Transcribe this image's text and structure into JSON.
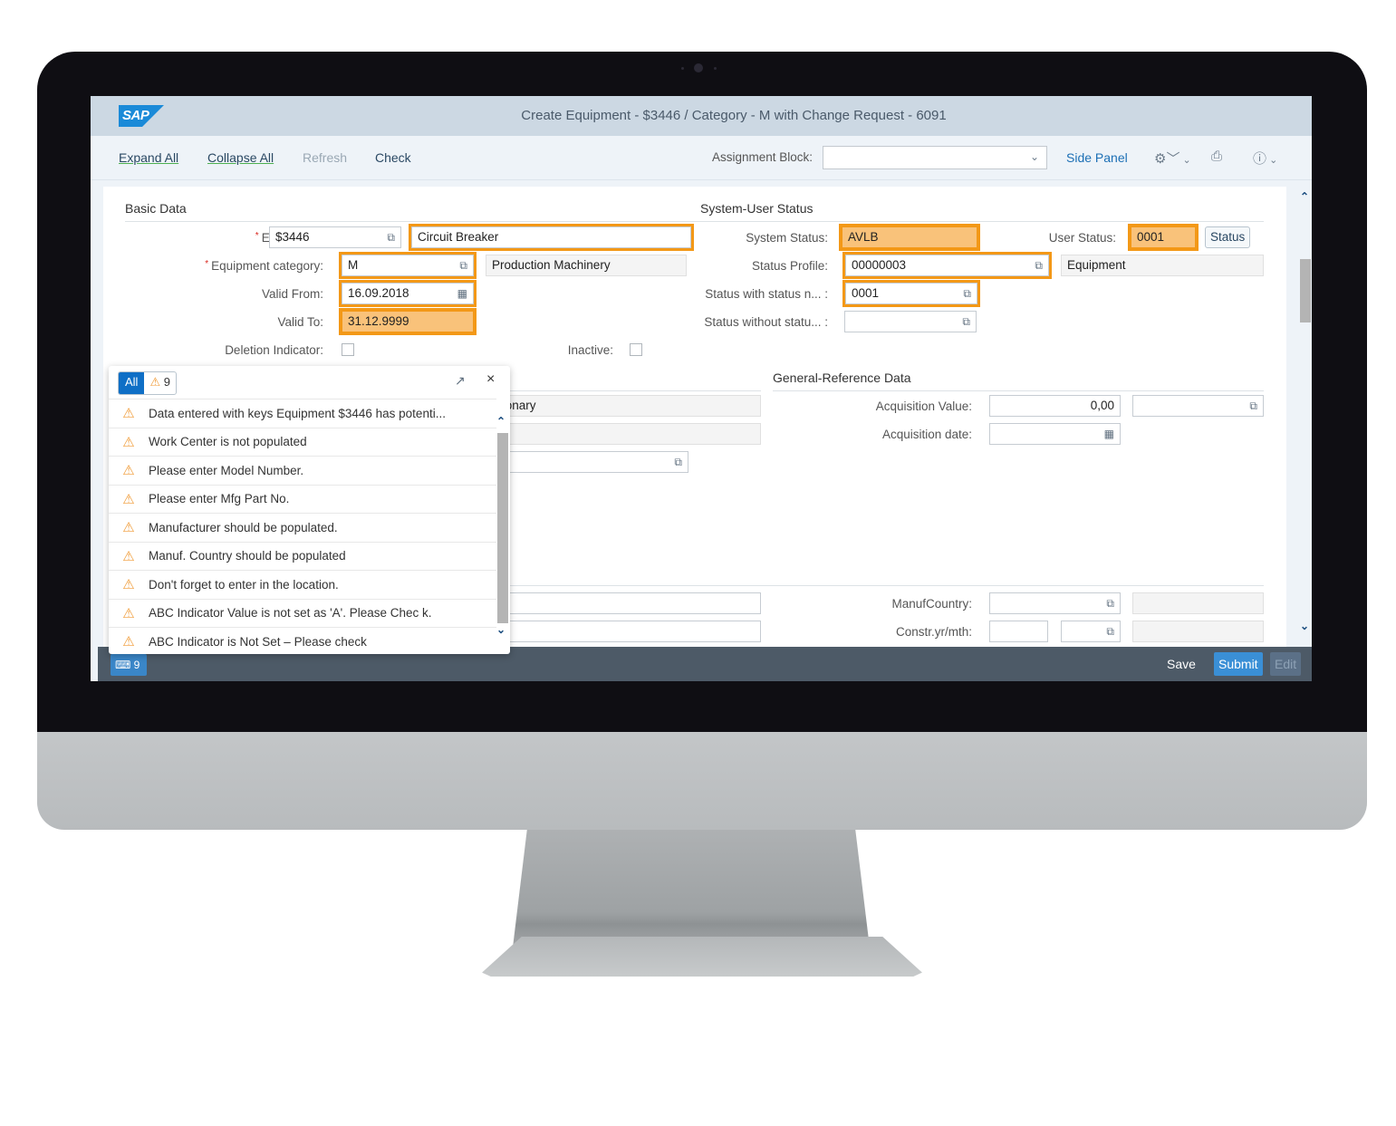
{
  "window": {
    "logo": "SAP",
    "title": "Create Equipment - $3446 / Category - M with Change Request - 6091"
  },
  "toolbar": {
    "expand_all": "Expand All",
    "collapse_all": "Collapse All",
    "refresh": "Refresh",
    "check": "Check",
    "assignment_block_label": "Assignment Block:",
    "assignment_block_value": "",
    "side_panel": "Side Panel",
    "icons": [
      "settings-icon",
      "print-icon",
      "help-icon"
    ]
  },
  "basic_data": {
    "title": "Basic Data",
    "equipment_label": "Equipment:",
    "equipment_value": "$3446",
    "equipment_description": "Circuit Breaker",
    "category_label": "Equipment category:",
    "category_value": "M",
    "category_description": "Production Machinery",
    "valid_from_label": "Valid From:",
    "valid_from_value": "16.09.2018",
    "valid_to_label": "Valid To:",
    "valid_to_value": "31.12.9999",
    "deletion_indicator_label": "Deletion Indicator:",
    "deletion_indicator_checked": false,
    "inactive_label": "Inactive:",
    "inactive_checked": false
  },
  "system_user_status": {
    "title": "System-User Status",
    "system_status_label": "System Status:",
    "system_status_value": "AVLB",
    "user_status_label": "User Status:",
    "user_status_value": "0001",
    "status_button": "Status",
    "status_profile_label": "Status Profile:",
    "status_profile_value": "00000003",
    "status_profile_description": "Equipment",
    "status_with_number_label": "Status with status n... :",
    "status_with_number_value": "0001",
    "status_without_number_label": "Status without statu... :",
    "status_without_number_value": ""
  },
  "partially_hidden": {
    "field1_value": "tionary"
  },
  "general_reference": {
    "title": "General-Reference Data",
    "acquisition_value_label": "Acquisition Value:",
    "acquisition_value": "0,00",
    "acquisition_currency": "",
    "acquisition_date_label": "Acquisition date:",
    "acquisition_date_value": "",
    "manuf_country_label": "ManufCountry:",
    "manuf_country_value": "",
    "constr_label": "Constr.yr/mth:",
    "constr_year": "",
    "constr_month": ""
  },
  "messages": {
    "filter_all": "All",
    "warning_count": "9",
    "items": [
      "Data entered with keys Equipment $3446 has potenti...",
      "Work Center is not populated",
      "Please enter Model Number.",
      "Please enter Mfg Part No.",
      "Manufacturer should be populated.",
      "Manuf. Country should be populated",
      "Don't forget to enter in the location.",
      "ABC Indicator Value is not set as 'A'. Please Chec k.",
      "ABC Indicator is Not Set – Please check"
    ]
  },
  "footer": {
    "message_count": "9",
    "save": "Save",
    "submit": "Submit",
    "edit": "Edit"
  },
  "colors": {
    "highlight": "#f39817",
    "highlight_fill": "#f9c27a",
    "accent": "#0f6fc6",
    "footer_bg": "#4d5a67"
  }
}
